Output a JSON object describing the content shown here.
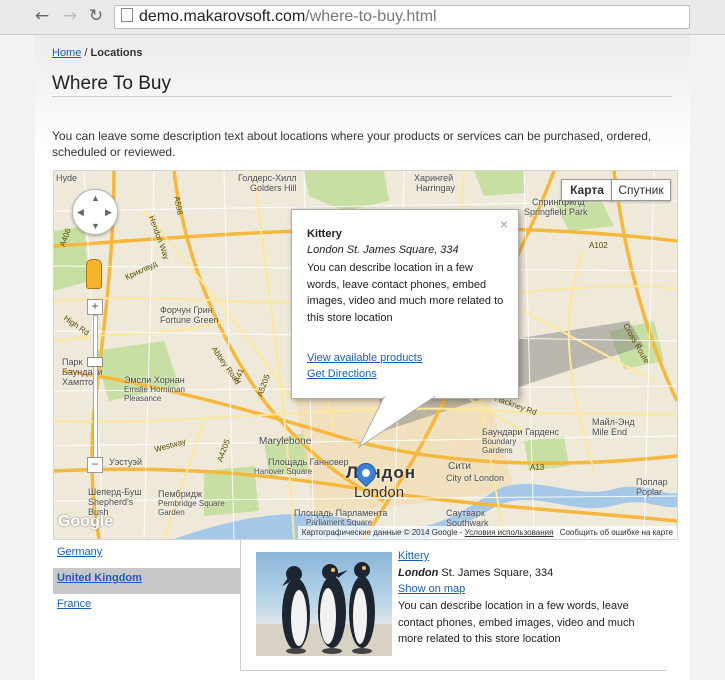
{
  "browser": {
    "url_host": "demo.makarovsoft.com",
    "url_path": "/where-to-buy.html"
  },
  "breadcrumb": {
    "home": "Home",
    "separator": " / ",
    "current": "Locations"
  },
  "page": {
    "title": "Where To Buy",
    "description": "You can leave some description text about locations where your products or services can be purchased, ordered, scheduled or reviewed."
  },
  "map": {
    "type_map": "Карта",
    "type_satellite": "Спутник",
    "zoom_in": "+",
    "zoom_out": "−",
    "city_primary": "Лондон",
    "city_secondary": "London",
    "attribution": "Картографические данные © 2014 Google",
    "terms": "Условия использования",
    "report": "Сообщить об ошибке на карте",
    "logo": "Google",
    "labels": {
      "hyde": "Hyde",
      "golders_hill": "Голдерс-Хилл",
      "golders_hill_en": "Golders Hill",
      "harringay": "Харингей",
      "harringay_en": "Harringay",
      "springfield": "Спрингфилд",
      "springfield_en": "Springfield Park",
      "hendon_way": "Hendon Way",
      "park": "Парк",
      "baundari": "Баундари",
      "hampton_way": "Хамптон",
      "emsli_hornan": "Эмсли Хорнан",
      "emsli_en": "Emslie Horniman Pleasance",
      "fortune_green": "Форчун Грин",
      "fortune_en": "Fortune Green",
      "high_rd": "High Rd",
      "abbey_road": "Abbey Road",
      "marylebone": "Marylebone",
      "westway": "Westway",
      "uxbridge_rd": "Уэстуэй",
      "hanover": "Площадь Ганновер",
      "hanover_en": "Hanover Square",
      "shepherds": "Шеперд-Буш",
      "shepherds_en": "Shepherd's Bush",
      "pembridge": "Пембридж",
      "pembridge_en": "Pembridge Square Garden",
      "parliament": "Площадь Парламента",
      "parliament_en": "Parliament Square",
      "city": "Сити",
      "city_en": "City of London",
      "southwark": "Саутварк",
      "southwark_en": "Southwark",
      "boundary": "Баундари Гарденс",
      "boundary_en": "Boundary Gardens",
      "mile_end": "Майл-Энд",
      "mile_end_en": "Mile End",
      "poplar": "Поплар",
      "poplar_en": "Poplar",
      "hackney": "Hackney Rd",
      "cross_route": "Cross Route",
      "a13": "A13",
      "a5205": "A5205",
      "a41": "A41",
      "a406": "A406",
      "a598": "A598",
      "a4205": "A4205",
      "a102": "A102",
      "krikl": "Криклвуд",
      "hendon": "Hendon Way",
      "a1": "A1",
      "a5": "A5"
    }
  },
  "info_window": {
    "close": "×",
    "title": "Kittery",
    "address": "London St. James Square, 334",
    "description": "You can describe location in a few words, leave contact phones, embed images, video and much more related to this store location",
    "link_products": "View available products",
    "link_directions": "Get Directions"
  },
  "countries": [
    {
      "name": "Germany",
      "active": false
    },
    {
      "name": "United Kingdom",
      "active": true
    },
    {
      "name": "France",
      "active": false
    }
  ],
  "store": {
    "name": "Kittery",
    "city": "London",
    "street": "St. James Square, 334",
    "show_on_map": "Show on map",
    "description": "You can describe location in a few words, leave contact phones, embed images, video and much more related to this store location"
  },
  "colors": {
    "link": "#1a5fb4",
    "road_major": "#f5b83d",
    "road_minor": "#fde79a",
    "park": "#c8dfa3",
    "water": "#a6c8e8",
    "pin": "#3b82d6"
  }
}
